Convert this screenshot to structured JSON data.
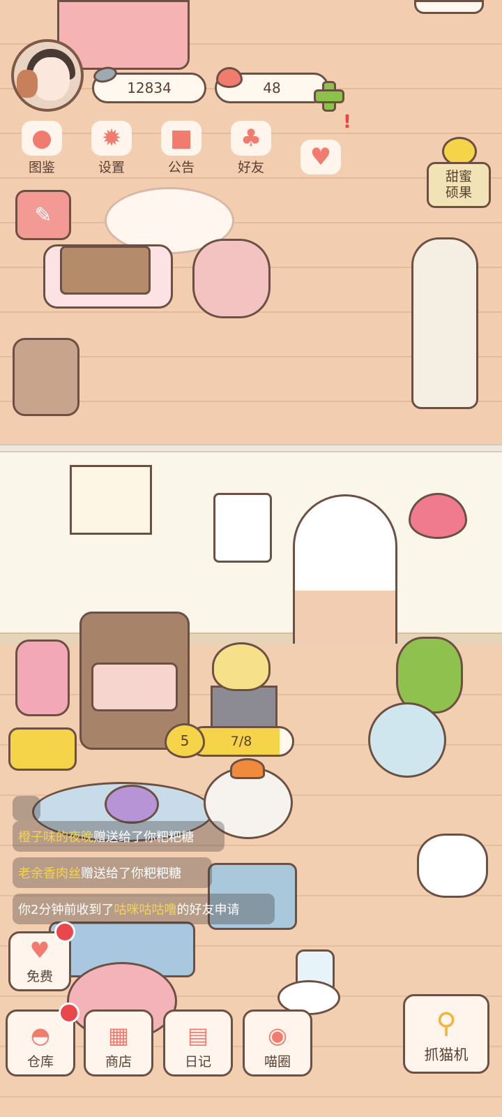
{
  "currency": {
    "fish_coins": "12834",
    "hearts": "48"
  },
  "menu": [
    {
      "label": "图鉴",
      "icon": "cat-book-icon"
    },
    {
      "label": "设置",
      "icon": "gear-icon"
    },
    {
      "label": "公告",
      "icon": "gift-icon"
    },
    {
      "label": "好友",
      "icon": "friends-icon"
    },
    {
      "label": "",
      "icon": "heart-chat-icon"
    }
  ],
  "honey": {
    "label_line1": "甜蜜",
    "label_line2": "硕果"
  },
  "chat": {
    "msg1_name": "橙子味的夜晚",
    "msg1_text": "赠送给了你粑粑糖",
    "msg2_name": "老余香肉丝",
    "msg2_text": "赠送给了你粑粑糖",
    "msg3_prefix": "你2分钟前收到了",
    "msg3_name": "咕咪咕咕噜",
    "msg3_suffix": "的好友申请"
  },
  "level": {
    "value": "5",
    "progress_text": "7/8",
    "progress_current": 7,
    "progress_max": 8
  },
  "bottom": {
    "free": "免费",
    "warehouse": "仓库",
    "shop": "商店",
    "diary": "日记",
    "meow_circle": "喵圈",
    "claw_machine": "抓猫机"
  },
  "colors": {
    "accent": "#f07b6e",
    "yellow": "#f6d44a",
    "badge_red": "#e9474c",
    "outline": "#6b5043"
  }
}
